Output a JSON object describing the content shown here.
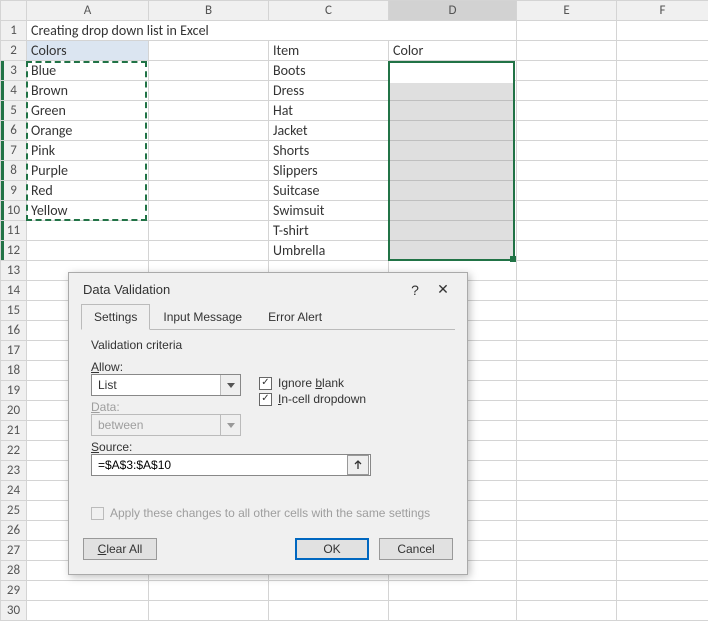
{
  "columns": [
    "A",
    "B",
    "C",
    "D",
    "E",
    "F"
  ],
  "title": "Creating drop down list in Excel",
  "headers": {
    "a2": "Colors",
    "c2": "Item",
    "d2": "Color"
  },
  "colors": [
    "Blue",
    "Brown",
    "Green",
    "Orange",
    "Pink",
    "Purple",
    "Red",
    "Yellow"
  ],
  "items": [
    "Boots",
    "Dress",
    "Hat",
    "Jacket",
    "Shorts",
    "Slippers",
    "Suitcase",
    "Swimsuit",
    "T-shirt",
    "Umbrella"
  ],
  "dialog": {
    "title": "Data Validation",
    "tabs": [
      "Settings",
      "Input Message",
      "Error Alert"
    ],
    "section": "Validation criteria",
    "allow_label": "Allow:",
    "allow_value": "List",
    "data_label": "Data:",
    "data_value": "between",
    "ignore_blank": "Ignore blank",
    "incell_dropdown": "In-cell dropdown",
    "source_label": "Source:",
    "source_value": "=$A$3:$A$10",
    "apply_all": "Apply these changes to all other cells with the same settings",
    "clear_all": "Clear All",
    "ok": "OK",
    "cancel": "Cancel"
  }
}
